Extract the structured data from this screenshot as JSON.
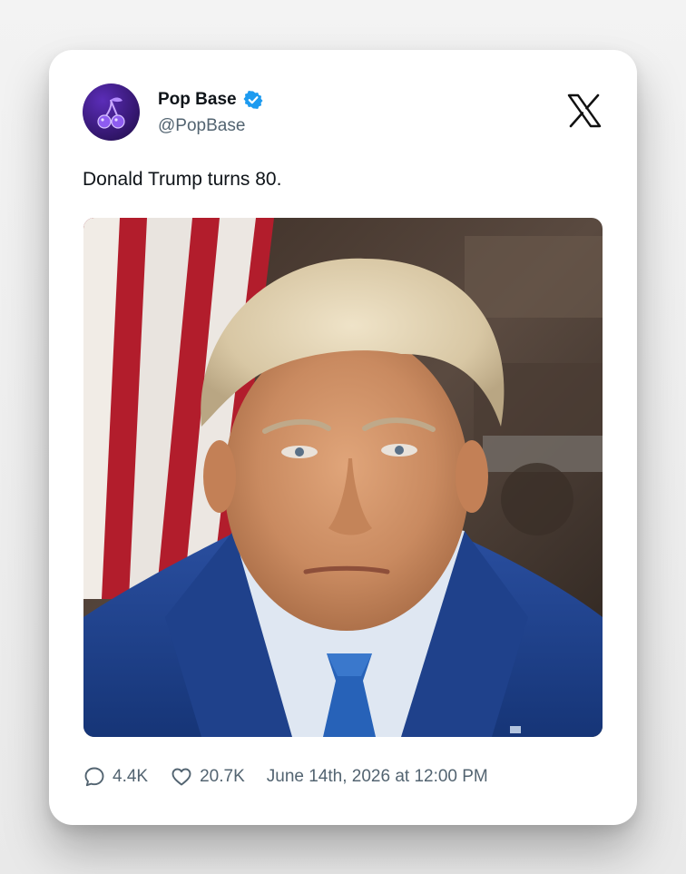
{
  "author": {
    "display_name": "Pop Base",
    "handle": "@PopBase",
    "verified": true,
    "avatar_icon": "cherry-icon"
  },
  "platform_icon": "x-logo-icon",
  "tweet": {
    "text": "Donald Trump turns 80.",
    "replies": "4.4K",
    "likes": "20.7K",
    "timestamp": "June 14th, 2026 at 12:00 PM"
  },
  "colors": {
    "verified_blue": "#1d9bf0",
    "text_primary": "#0f1419",
    "text_secondary": "#536471"
  }
}
